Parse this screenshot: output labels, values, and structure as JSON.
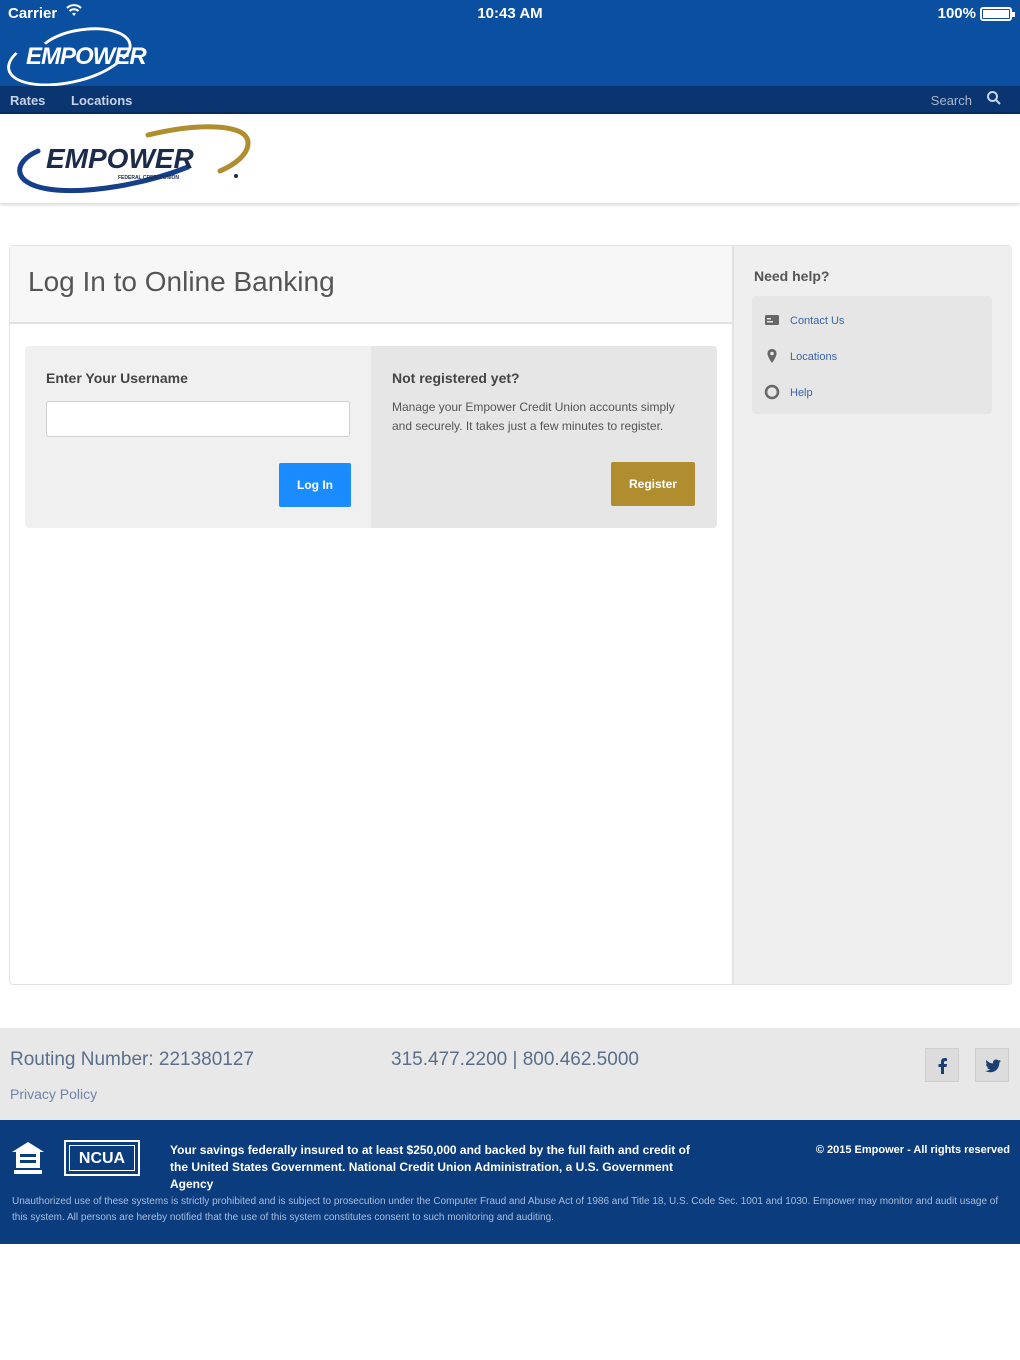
{
  "status_bar": {
    "carrier": "Carrier",
    "time": "10:43 AM",
    "battery": "100%"
  },
  "app_header": {
    "logo_text": "EMPOWER"
  },
  "nav": {
    "rates": "Rates",
    "locations": "Locations",
    "search": "Search"
  },
  "brand": {
    "name": "EMPOWER",
    "tagline": "FEDERAL CREDIT UNION"
  },
  "login": {
    "title": "Log In to Online Banking",
    "username_label": "Enter Your Username",
    "username_value": "",
    "login_button": "Log In",
    "register_title": "Not registered yet?",
    "register_text": "Manage your Empower Credit Union accounts simply and securely. It takes just a few minutes to register.",
    "register_button": "Register"
  },
  "help": {
    "title": "Need help?",
    "items": [
      {
        "label": "Contact Us",
        "icon": "contact-card-icon"
      },
      {
        "label": "Locations",
        "icon": "map-pin-icon"
      },
      {
        "label": "Help",
        "icon": "lifebuoy-icon"
      }
    ]
  },
  "footer": {
    "routing": "Routing Number: 221380127",
    "phones": "315.477.2200  |  800.462.5000",
    "privacy": "Privacy Policy",
    "ncua": "NCUA",
    "insured": "Your savings federally insured to at least $250,000 and backed by the full faith and credit of the United States Government. National Credit Union Administration, a U.S. Government Agency",
    "copyright": "© 2015 Empower - All rights reserved",
    "legal": "Unauthorized use of these systems is strictly prohibited and is subject to prosecution under the Computer Fraud and Abuse Act of 1986 and Title 18, U.S. Code Sec. 1001 and 1030. Empower may monitor and audit usage of this system. All persons are hereby notified that the use of this system constitutes consent to such monitoring and auditing."
  },
  "colors": {
    "header_blue": "#0b4fa0",
    "nav_blue": "#0a3570",
    "login_button": "#1a8cff",
    "register_button": "#b08d2e",
    "footer_blue": "#0b3d7e"
  }
}
